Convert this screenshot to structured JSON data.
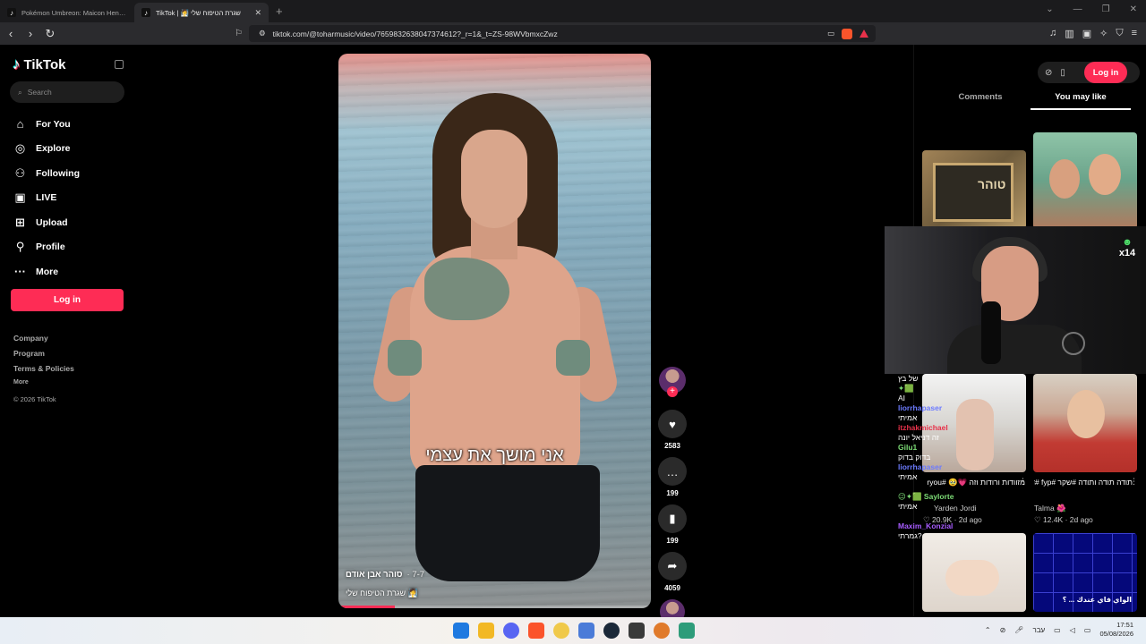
{
  "browser": {
    "tabs": [
      {
        "title": "Pokémon Umbreon: Maicon Henriqu..."
      },
      {
        "title": "TikTok | 🧖 שגרת הטיפוח שלי"
      }
    ],
    "url": "tiktok.com/@toharmusic/video/7659832638047374612?_r=1&_t=ZS-98WVbmxcZwz"
  },
  "sidebar": {
    "brand": "TikTok",
    "search_placeholder": "Search",
    "menu": [
      {
        "label": "For You",
        "icon": "home-icon"
      },
      {
        "label": "Explore",
        "icon": "compass-icon"
      },
      {
        "label": "Following",
        "icon": "user-icon"
      },
      {
        "label": "LIVE",
        "icon": "live-icon"
      },
      {
        "label": "Upload",
        "icon": "upload-icon"
      },
      {
        "label": "Profile",
        "icon": "profile-icon"
      },
      {
        "label": "More",
        "icon": "more-icon"
      }
    ],
    "login": "Log in",
    "footer": [
      "Company",
      "Program",
      "Terms & Policies"
    ],
    "footer_more": "More",
    "copyright": "© 2026 TikTok"
  },
  "video": {
    "caption": "אני מושך את עצמי",
    "author": "סוהר אבן אודם",
    "date": "· 7-7",
    "description": "שגרת הטיפוח שלי 🧖",
    "progress": 0.18
  },
  "actions": {
    "likes": "2583",
    "comments": "199",
    "saves": "199",
    "shares": "4059"
  },
  "right_panel": {
    "login": "Log in",
    "tabs": [
      "Comments",
      "You may like"
    ],
    "active_tab": "You may like",
    "thumb1_text": "טוהר",
    "cards": [
      {
        "desc": "מזוודות ורודות וזה 💗🥹 #foryou #טספליק",
        "author": "Yarden Jordi",
        "likes": "20.9K",
        "age": "2d ago"
      },
      {
        "desc": "תודה תודה ותודה #שקר #fyp #דניאל_יונה #סוריו",
        "author": "Talma 🌺",
        "likes": "12.4K",
        "age": "2d ago"
      }
    ],
    "thumb6_text": "الواي فاي عندك ... ؟"
  },
  "chat": [
    {
      "user": "",
      "msg": "של בץ",
      "cls": "msg"
    },
    {
      "user": "✦🟩",
      "msg": "",
      "cls": "u-green"
    },
    {
      "user": "",
      "msg": "AI",
      "cls": "msg"
    },
    {
      "user": "liorrhapaser",
      "msg": "",
      "cls": "u-blue"
    },
    {
      "user": "",
      "msg": "אמיתי",
      "cls": "msg"
    },
    {
      "user": "itzhakmichael",
      "msg": "",
      "cls": "u-red"
    },
    {
      "user": "",
      "msg": "זה דניאל יונה",
      "cls": "msg"
    },
    {
      "user": "Gilu1",
      "msg": "",
      "cls": "u-green"
    },
    {
      "user": "",
      "msg": "בדוק בדוק",
      "cls": "msg"
    },
    {
      "user": "liorrhapaser",
      "msg": "",
      "cls": "u-blue"
    },
    {
      "user": "",
      "msg": "אמיתי",
      "cls": "msg"
    },
    {
      "user": "",
      "msg": "",
      "cls": "msg"
    },
    {
      "user": "😉✦🟩 Saylorte",
      "msg": "",
      "cls": "u-green"
    },
    {
      "user": "",
      "msg": "אמיתי",
      "cls": "msg"
    },
    {
      "user": "",
      "msg": "",
      "cls": "msg"
    },
    {
      "user": "Maxim_Konzial",
      "msg": "",
      "cls": "u-purple"
    },
    {
      "user": "",
      "msg": "גמרתי?",
      "cls": "msg"
    }
  ],
  "taskbar": {
    "lang": "עבר",
    "time": "17:51",
    "date": "05/08/2026"
  },
  "colors": {
    "accent": "#fe2c55",
    "background": "#000000"
  }
}
